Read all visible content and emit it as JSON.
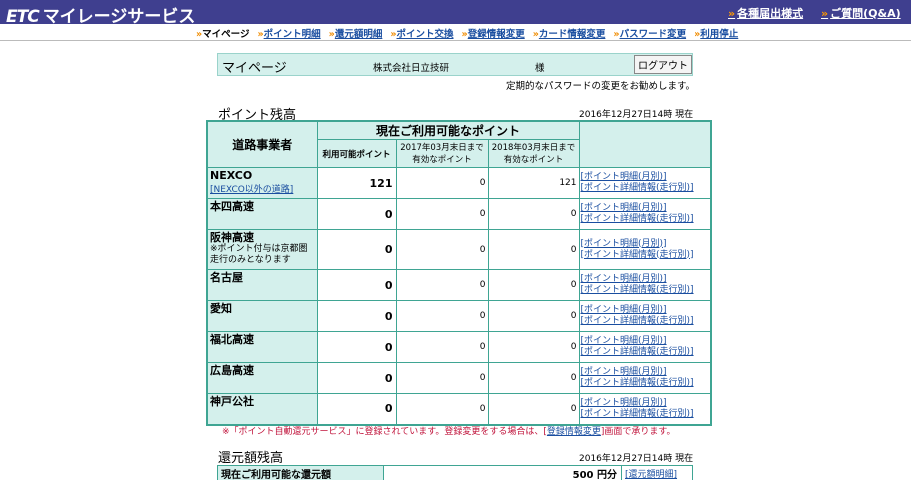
{
  "header": {
    "logo_etc": "ETC",
    "logo_title": "マイレージサービス",
    "links": [
      "各種届出様式",
      "ご質問(Q&A)"
    ]
  },
  "nav": {
    "items": [
      "マイページ",
      "ポイント明細",
      "還元額明細",
      "ポイント交換",
      "登録情報変更",
      "カード情報変更",
      "パスワード変更",
      "利用停止"
    ]
  },
  "mypage": {
    "title": "マイページ",
    "company": "株式会社日立技研",
    "honorific": "様",
    "logout_label": "ログアウト",
    "password_notice": "定期的なパスワードの変更をお勧めします。"
  },
  "points": {
    "heading": "ポイント残高",
    "as_of": "2016年12月27日14時 現在",
    "header_operator": "道路事業者",
    "header_current": "現在ご利用可能なポイント",
    "header_available": "利用可能ポイント",
    "header_exp1": [
      "2017年03月末日まで",
      "有効なポイント"
    ],
    "header_exp2": [
      "2018年03月末日まで",
      "有効なポイント"
    ],
    "link_monthly": "[ポイント明細(月別)]",
    "link_detail": "[ポイント詳細情報(走行別)]",
    "rows": [
      {
        "operator": "NEXCO",
        "sublink": "[NEXCO以外の道路]",
        "note": "",
        "available": "121",
        "exp1": "0",
        "exp2": "121"
      },
      {
        "operator": "本四高速",
        "sublink": "",
        "note": "",
        "available": "0",
        "exp1": "0",
        "exp2": "0"
      },
      {
        "operator": "阪神高速",
        "sublink": "",
        "note": "※ポイント付与は京都圏走行のみとなります",
        "available": "0",
        "exp1": "0",
        "exp2": "0"
      },
      {
        "operator": "名古屋",
        "sublink": "",
        "note": "",
        "available": "0",
        "exp1": "0",
        "exp2": "0"
      },
      {
        "operator": "愛知",
        "sublink": "",
        "note": "",
        "available": "0",
        "exp1": "0",
        "exp2": "0"
      },
      {
        "operator": "福北高速",
        "sublink": "",
        "note": "",
        "available": "0",
        "exp1": "0",
        "exp2": "0"
      },
      {
        "operator": "広島高速",
        "sublink": "",
        "note": "",
        "available": "0",
        "exp1": "0",
        "exp2": "0"
      },
      {
        "operator": "神戸公社",
        "sublink": "",
        "note": "",
        "available": "0",
        "exp1": "0",
        "exp2": "0"
      }
    ],
    "auto_notice_before": "※「ポイント自動還元サービス」に登録されています。登録変更をする場合は、[",
    "auto_notice_link": "登録情報変更",
    "auto_notice_after": "]画面で承ります。"
  },
  "refund": {
    "heading": "還元額残高",
    "as_of": "2016年12月27日14時 現在",
    "label": "現在ご利用可能な還元額",
    "value": "500 円分",
    "link": "[還元額明細]"
  },
  "colors": {
    "header_bg": "#3f3f8f",
    "table_border": "#3fa593",
    "cell_bg": "#d4f0ec",
    "link": "#1a4ea0",
    "notice": "#c0143c"
  }
}
